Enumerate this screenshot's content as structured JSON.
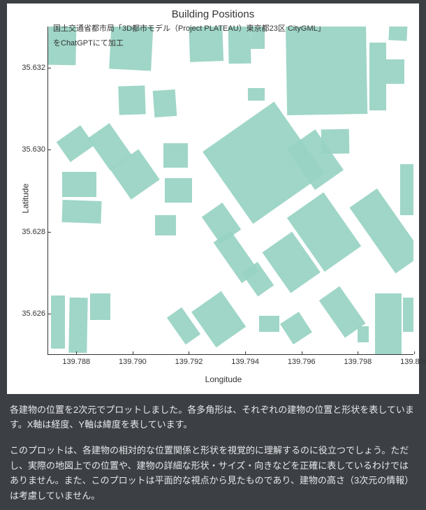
{
  "chart_data": {
    "type": "map",
    "title": "Building Positions",
    "xlabel": "Longitude",
    "ylabel": "Latitude",
    "xlim": [
      139.787,
      139.8
    ],
    "ylim": [
      35.625,
      35.633
    ],
    "x_ticks": [
      139.788,
      139.79,
      139.792,
      139.794,
      139.796,
      139.798,
      139.8
    ],
    "y_ticks": [
      35.626,
      35.628,
      35.63,
      35.632
    ],
    "annotation_line1": "国土交通省都市局「3D都市モデル（Project PLATEAU）東京都23区 CityGML」",
    "annotation_line2": "をChatGPTにて加工",
    "buildings_approx": [
      {
        "lon_min": 139.787,
        "lon_max": 139.788,
        "lat_min": 35.63205,
        "lat_max": 35.6333,
        "rot": 1
      },
      {
        "lon_min": 139.7892,
        "lon_max": 139.7907,
        "lat_min": 35.63195,
        "lat_max": 35.63315,
        "rot": 3
      },
      {
        "lon_min": 139.792,
        "lon_max": 139.7932,
        "lat_min": 35.63215,
        "lat_max": 35.6332,
        "rot": -2
      },
      {
        "lon_min": 139.7934,
        "lon_max": 139.7942,
        "lat_min": 35.6321,
        "lat_max": 35.6332,
        "rot": -1
      },
      {
        "lon_min": 139.7942,
        "lon_max": 139.7947,
        "lat_min": 35.63245,
        "lat_max": 35.63302,
        "rot": 0
      },
      {
        "lon_min": 139.79545,
        "lon_max": 139.7983,
        "lat_min": 35.63085,
        "lat_max": 35.6332,
        "rot": -1
      },
      {
        "lon_min": 139.7984,
        "lon_max": 139.799,
        "lat_min": 35.63095,
        "lat_max": 35.6326,
        "rot": 0
      },
      {
        "lon_min": 139.7991,
        "lon_max": 139.79975,
        "lat_min": 35.63265,
        "lat_max": 35.6331,
        "rot": 3
      },
      {
        "lon_min": 139.799,
        "lon_max": 139.79965,
        "lat_min": 35.6316,
        "lat_max": 35.6322,
        "rot": 0
      },
      {
        "lon_min": 139.7895,
        "lon_max": 139.79045,
        "lat_min": 35.63085,
        "lat_max": 35.63155,
        "rot": -2
      },
      {
        "lon_min": 139.79075,
        "lon_max": 139.79155,
        "lat_min": 35.6308,
        "lat_max": 35.63145,
        "rot": -4
      },
      {
        "lon_min": 139.7941,
        "lon_max": 139.7947,
        "lat_min": 35.6312,
        "lat_max": 35.6315,
        "rot": 0
      },
      {
        "lon_min": 139.78745,
        "lon_max": 139.7885,
        "lat_min": 35.62985,
        "lat_max": 35.63045,
        "rot": -35
      },
      {
        "lon_min": 139.7887,
        "lon_max": 139.78965,
        "lat_min": 35.6296,
        "lat_max": 35.63055,
        "rot": -35
      },
      {
        "lon_min": 139.78945,
        "lon_max": 139.7907,
        "lat_min": 35.62895,
        "lat_max": 35.62985,
        "rot": -35
      },
      {
        "lon_min": 139.7875,
        "lon_max": 139.7887,
        "lat_min": 35.62885,
        "lat_max": 35.62945,
        "rot": 0
      },
      {
        "lon_min": 139.7875,
        "lon_max": 139.7889,
        "lat_min": 35.6282,
        "lat_max": 35.62875,
        "rot": 2
      },
      {
        "lon_min": 139.7911,
        "lon_max": 139.79195,
        "lat_min": 35.62955,
        "lat_max": 35.63015,
        "rot": 0
      },
      {
        "lon_min": 139.79115,
        "lon_max": 139.7921,
        "lat_min": 35.6287,
        "lat_max": 35.6293,
        "rot": 0
      },
      {
        "lon_min": 139.7908,
        "lon_max": 139.79155,
        "lat_min": 35.6279,
        "lat_max": 35.6284,
        "rot": 0
      },
      {
        "lon_min": 139.7931,
        "lon_max": 139.7962,
        "lat_min": 35.6286,
        "lat_max": 35.63075,
        "rot": -35
      },
      {
        "lon_min": 139.79585,
        "lon_max": 139.7971,
        "lat_min": 35.62915,
        "lat_max": 35.63035,
        "rot": -35
      },
      {
        "lon_min": 139.7967,
        "lon_max": 139.7977,
        "lat_min": 35.6299,
        "lat_max": 35.6305,
        "rot": -1
      },
      {
        "lon_min": 139.7927,
        "lon_max": 139.7936,
        "lat_min": 35.6278,
        "lat_max": 35.6286,
        "rot": -35
      },
      {
        "lon_min": 139.7933,
        "lon_max": 139.79405,
        "lat_min": 35.6268,
        "lat_max": 35.628,
        "rot": -35
      },
      {
        "lon_min": 139.7941,
        "lon_max": 139.7948,
        "lat_min": 35.6265,
        "lat_max": 35.6272,
        "rot": -35
      },
      {
        "lon_min": 139.795,
        "lon_max": 139.7963,
        "lat_min": 35.62665,
        "lat_max": 35.62785,
        "rot": -35
      },
      {
        "lon_min": 139.796,
        "lon_max": 139.7976,
        "lat_min": 35.6272,
        "lat_max": 35.6288,
        "rot": -35
      },
      {
        "lon_min": 139.797,
        "lon_max": 139.7979,
        "lat_min": 35.6255,
        "lat_max": 35.6266,
        "rot": -35
      },
      {
        "lon_min": 139.7924,
        "lon_max": 139.7937,
        "lat_min": 35.62535,
        "lat_max": 35.6264,
        "rot": -35
      },
      {
        "lon_min": 139.7915,
        "lon_max": 139.79215,
        "lat_min": 35.6253,
        "lat_max": 35.6261,
        "rot": -35
      },
      {
        "lon_min": 139.7945,
        "lon_max": 139.7952,
        "lat_min": 35.62555,
        "lat_max": 35.62595,
        "rot": 0
      },
      {
        "lon_min": 139.7954,
        "lon_max": 139.7962,
        "lat_min": 35.62535,
        "lat_max": 35.62595,
        "rot": -33
      },
      {
        "lon_min": 139.7871,
        "lon_max": 139.7876,
        "lat_min": 35.62515,
        "lat_max": 35.62645,
        "rot": 0
      },
      {
        "lon_min": 139.78775,
        "lon_max": 139.7884,
        "lat_min": 35.62505,
        "lat_max": 35.6264,
        "rot": 1
      },
      {
        "lon_min": 139.7885,
        "lon_max": 139.7892,
        "lat_min": 35.62585,
        "lat_max": 35.6265,
        "rot": 0
      },
      {
        "lon_min": 139.7984,
        "lon_max": 139.7996,
        "lat_min": 35.62705,
        "lat_max": 35.629,
        "rot": -35
      },
      {
        "lon_min": 139.7995,
        "lon_max": 139.80005,
        "lat_min": 35.6284,
        "lat_max": 35.62965,
        "rot": 0
      },
      {
        "lon_min": 139.7986,
        "lon_max": 139.79955,
        "lat_min": 35.625,
        "lat_max": 35.6265,
        "rot": 0
      },
      {
        "lon_min": 139.7996,
        "lon_max": 139.80005,
        "lat_min": 35.62555,
        "lat_max": 35.6264,
        "rot": 0
      },
      {
        "lon_min": 139.798,
        "lon_max": 139.7984,
        "lat_min": 35.6253,
        "lat_max": 35.6257,
        "rot": 0
      }
    ]
  },
  "description": {
    "para1": "各建物の位置を2次元でプロットしました。各多角形は、それぞれの建物の位置と形状を表しています。X軸は経度、Y軸は緯度を表しています。",
    "para2": "このプロットは、各建物の相対的な位置関係と形状を視覚的に理解するのに役立つでしょう。ただし、実際の地図上での位置や、建物の詳細な形状・サイズ・向きなどを正確に表しているわけではありません。また、このプロットは平面的な視点から見たものであり、建物の高さ（3次元の情報）は考慮していません。"
  }
}
